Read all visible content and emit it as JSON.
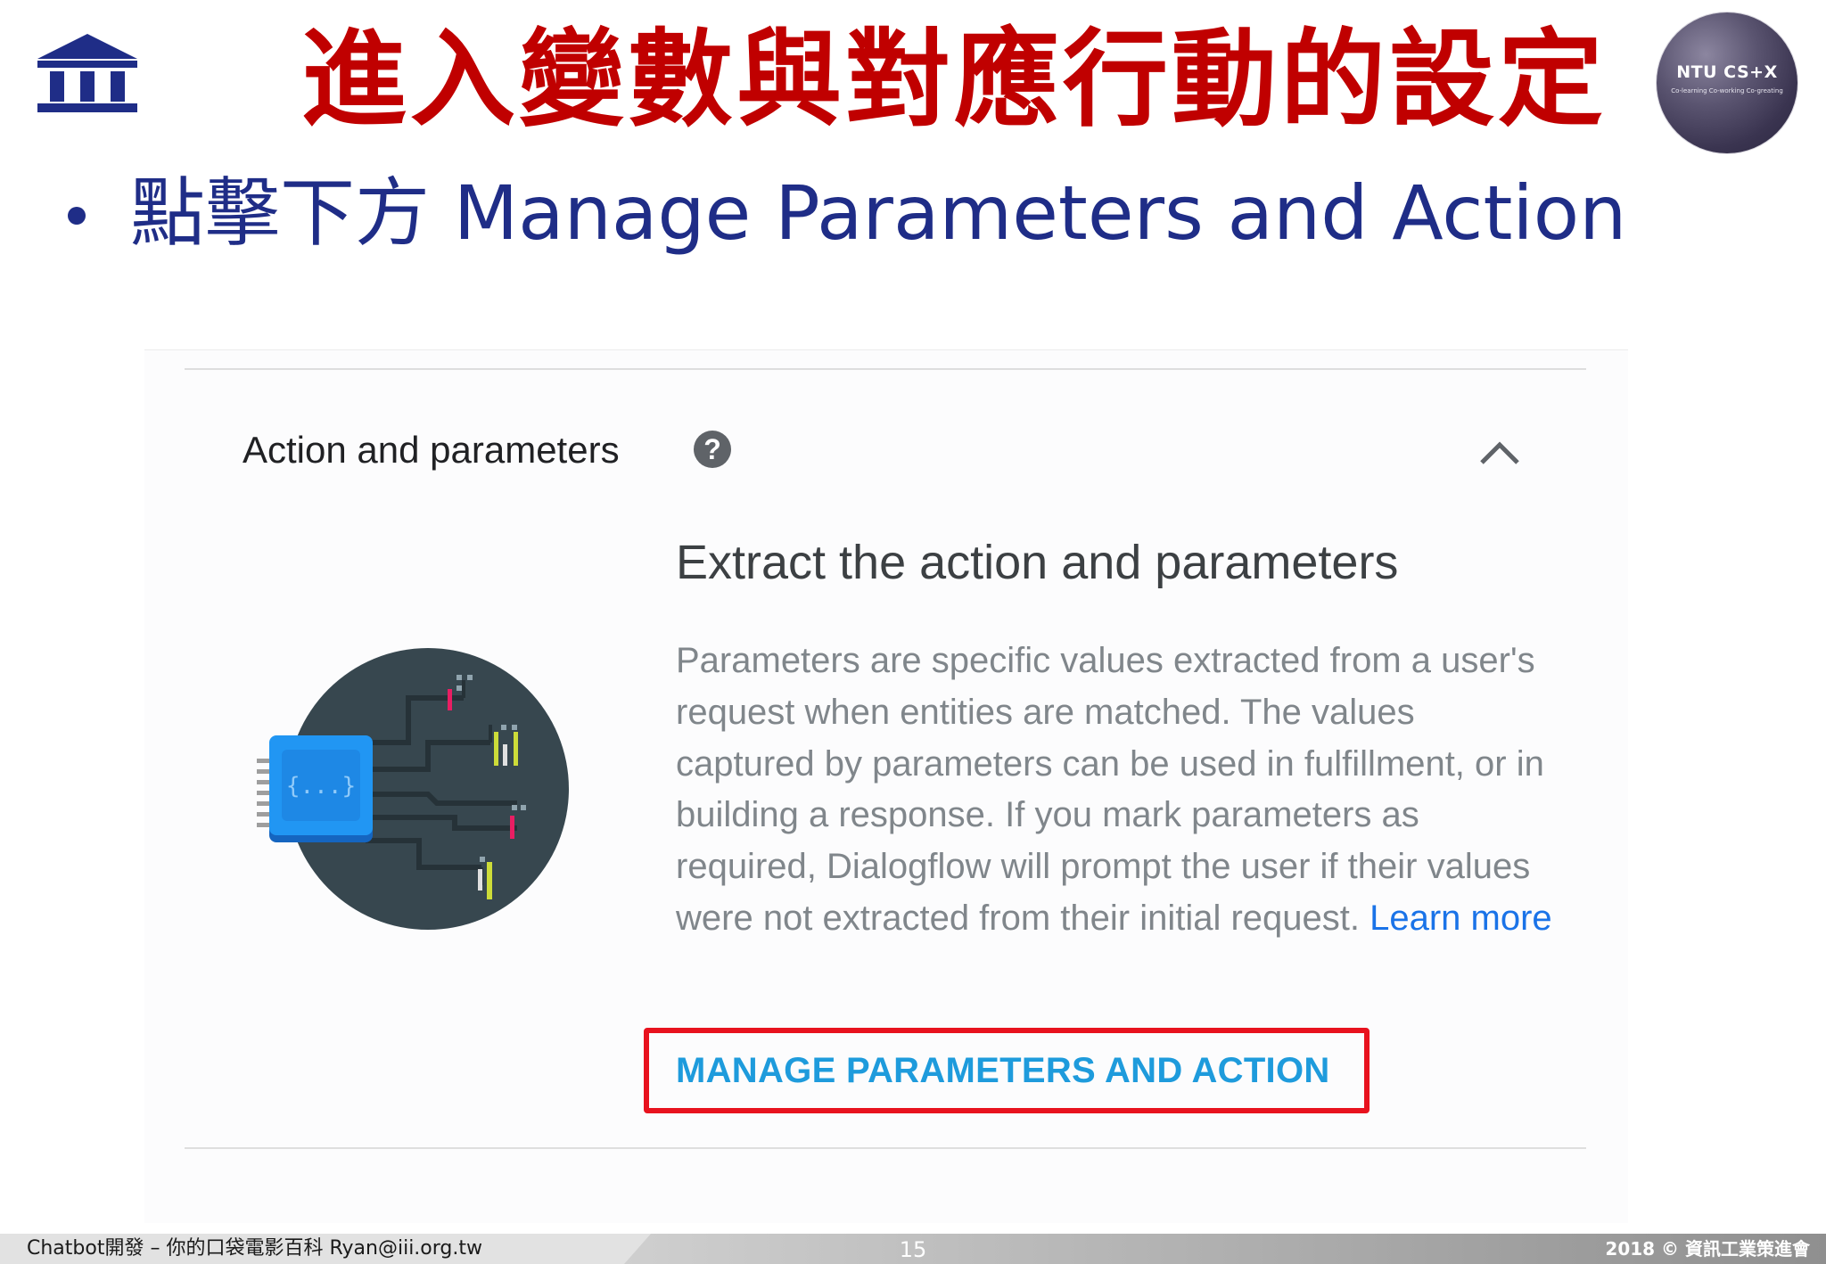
{
  "slide": {
    "title": "進入變數與對應行動的設定",
    "bullet": "點擊下方 Manage Parameters and Action",
    "logo_left_icon": "institute-building-icon",
    "logo_right": {
      "title": "NTU CS+X",
      "subtitle": "Co-learning Co-working Co-greating"
    }
  },
  "screenshot": {
    "section_title": "Action and parameters",
    "help_icon": "help-circle-icon",
    "chevron_icon": "chevron-up-icon",
    "illustration_icon": "circuit-chip-illustration",
    "chip_label": "{...}",
    "heading": "Extract the action and parameters",
    "description": "Parameters are specific values extracted from a user's request when entities are matched. The values captured by parameters can be used in fulfillment, or in building a response. If you mark parameters as required, Dialogflow will prompt the user if their values were not extracted from their initial request.",
    "learn_more": "Learn more",
    "manage_button": "MANAGE PARAMETERS AND ACTION",
    "highlight_color": "#e8121e",
    "link_color": "#1a73e8",
    "button_color": "#1e9bdc"
  },
  "footer": {
    "left": "Chatbot開發 – 你的口袋電影百科 Ryan@iii.org.tw",
    "page_number": "15",
    "right": "2018 © 資訊工業策進會"
  },
  "colors": {
    "title_red": "#c00000",
    "bullet_blue": "#1f2d87"
  }
}
